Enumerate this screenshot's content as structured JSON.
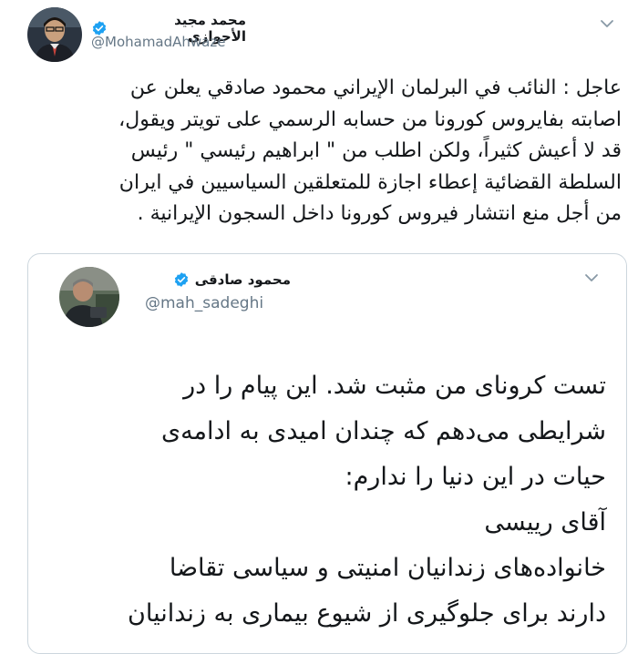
{
  "tweet": {
    "author_name": "محمد مجيد الأحوازي",
    "handle": "@MohamadAhwaze",
    "verified": true,
    "text": "عاجل : النائب في البرلمان الإيراني محمود صادقي يعلن عن\nاصابته بفايروس كورونا من حسابه الرسمي على تويتر ويقول،\nقد لا أعيش كثيراً، ولكن اطلب من \" ابراهيم رئيسي \" رئيس\nالسلطة القضائية إعطاء اجازة للمتعلقين السياسيين في ايران\nمن أجل منع انتشار فيروس كورونا داخل السجون الإيرانية .",
    "menu_icon": "chevron-down-icon"
  },
  "quoted_tweet": {
    "author_name": "محمود صادقی",
    "handle": "@mah_sadeghi",
    "verified": true,
    "text": "تست کرونای من مثبت شد. این پیام را در\nشرایطی می‌دهم که چندان امیدی به ادامه‌ی\nحیات در این دنیا را ندارم:\nآقای رییسی\nخانواده‌های زندانیان امنیتی و سیاسی تقاضا\nدارند برای جلوگیری از شیوع بیماری به زندانیان",
    "menu_icon": "chevron-down-icon"
  },
  "colors": {
    "verified_blue": "#1da1f2",
    "handle_gray": "#657786",
    "border": "#ccd6dd"
  }
}
